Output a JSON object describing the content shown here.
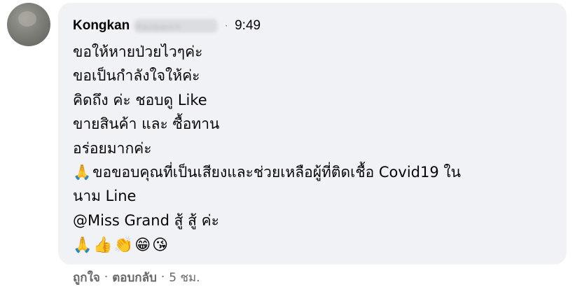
{
  "comment": {
    "author_first": "Kongkan",
    "author_last_blurred": "Rasiipanich",
    "separator": "·",
    "time": "9:49",
    "lines": [
      "ขอให้หายป่วยไวๆค่ะ",
      "ขอเป็นกำลังใจให้ค่ะ",
      "คิดถึง ค่ะ ชอบดู Like",
      "ขายสินค้า และ ซื้อทาน",
      "อร่อยมากค่ะ",
      "ขอขอบคุณที่เป็นเสียงและช่วยเหลือผู้ที่ติดเชื้อ Covid19 ใน",
      "นาม Line",
      "@Miss Grand สู้ สู้ ค่ะ"
    ],
    "line6_prefix_emoji": "🙏",
    "emoji_row": [
      "🙏",
      "👍",
      "👏",
      "😁",
      "😘"
    ]
  },
  "actions": {
    "like": "ถูกใจ",
    "reply": "ตอบกลับ",
    "dot": "·",
    "age": "5 ชม."
  },
  "colors": {
    "bubble": "#f0f2f5",
    "secondary_text": "#65676b",
    "primary_text": "#050505"
  },
  "icons": {
    "avatar": "profile-photo"
  }
}
